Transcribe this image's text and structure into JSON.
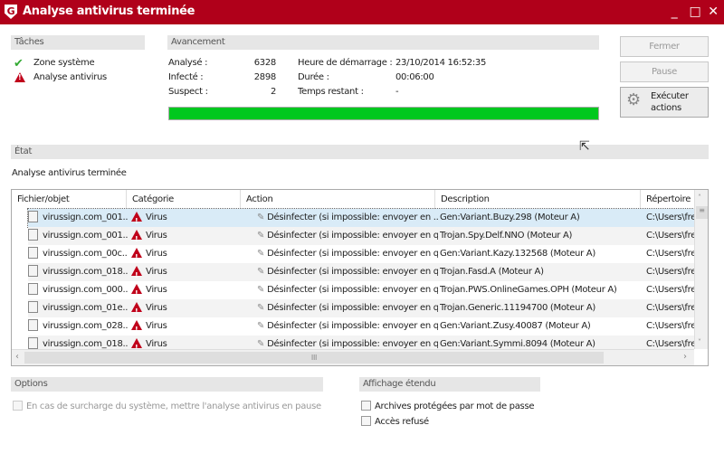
{
  "window": {
    "title": "Analyse antivirus terminée",
    "logo": "G",
    "minimize": "_",
    "maximize": "□",
    "close": "✕"
  },
  "tasks": {
    "header": "Tâches",
    "items": [
      {
        "label": "Zone système",
        "status": "ok"
      },
      {
        "label": "Analyse antivirus",
        "status": "warning"
      }
    ]
  },
  "progress": {
    "header": "Avancement",
    "analysed_label": "Analysé :",
    "analysed": "6328",
    "infected_label": "Infecté :",
    "infected": "2898",
    "suspect_label": "Suspect :",
    "suspect": "2",
    "start_label": "Heure de démarrage :",
    "start": "23/10/2014 16:52:35",
    "duration_label": "Durée :",
    "duration": "00:06:00",
    "remaining_label": "Temps restant :",
    "remaining": "-",
    "percent": 100,
    "bar_color": "#00c81e"
  },
  "buttons": {
    "close": "Fermer",
    "pause": "Pause",
    "execute": "Exécuter actions"
  },
  "state": {
    "header": "État",
    "status": "Analyse antivirus terminée"
  },
  "table": {
    "columns": [
      "Fichier/objet",
      "Catégorie",
      "Action",
      "Description",
      "Répertoire"
    ],
    "rows": [
      {
        "file": "virussign.com_001...",
        "category": "Virus",
        "action": "Désinfecter (si impossible: envoyer en ...",
        "description": "Gen:Variant.Buzy.298 (Moteur A)",
        "dir": "C:\\Users\\fre"
      },
      {
        "file": "virussign.com_001...",
        "category": "Virus",
        "action": "Désinfecter (si impossible: envoyer en qua...",
        "description": "Trojan.Spy.Delf.NNO (Moteur A)",
        "dir": "C:\\Users\\fre"
      },
      {
        "file": "virussign.com_00c...",
        "category": "Virus",
        "action": "Désinfecter (si impossible: envoyer en qua...",
        "description": "Gen:Variant.Kazy.132568 (Moteur A)",
        "dir": "C:\\Users\\fre"
      },
      {
        "file": "virussign.com_018...",
        "category": "Virus",
        "action": "Désinfecter (si impossible: envoyer en qua...",
        "description": "Trojan.Fasd.A (Moteur A)",
        "dir": "C:\\Users\\fre"
      },
      {
        "file": "virussign.com_000...",
        "category": "Virus",
        "action": "Désinfecter (si impossible: envoyer en qua...",
        "description": "Trojan.PWS.OnlineGames.OPH (Moteur A)",
        "dir": "C:\\Users\\fre"
      },
      {
        "file": "virussign.com_01e...",
        "category": "Virus",
        "action": "Désinfecter (si impossible: envoyer en qua...",
        "description": "Trojan.Generic.11194700 (Moteur A)",
        "dir": "C:\\Users\\fre"
      },
      {
        "file": "virussign.com_028...",
        "category": "Virus",
        "action": "Désinfecter (si impossible: envoyer en qua...",
        "description": "Gen:Variant.Zusy.40087 (Moteur A)",
        "dir": "C:\\Users\\fre"
      },
      {
        "file": "virussign.com_018...",
        "category": "Virus",
        "action": "Désinfecter (si impossible: envoyer en qua...",
        "description": "Gen:Variant.Symmi.8094 (Moteur A)",
        "dir": "C:\\Users\\fre"
      }
    ]
  },
  "options": {
    "header": "Options",
    "pause_on_load": "En cas de surcharge du système, mettre l'analyse antivirus en pause"
  },
  "extended": {
    "header": "Affichage étendu",
    "archives": "Archives protégées par mot de passe",
    "denied": "Accès refusé"
  }
}
